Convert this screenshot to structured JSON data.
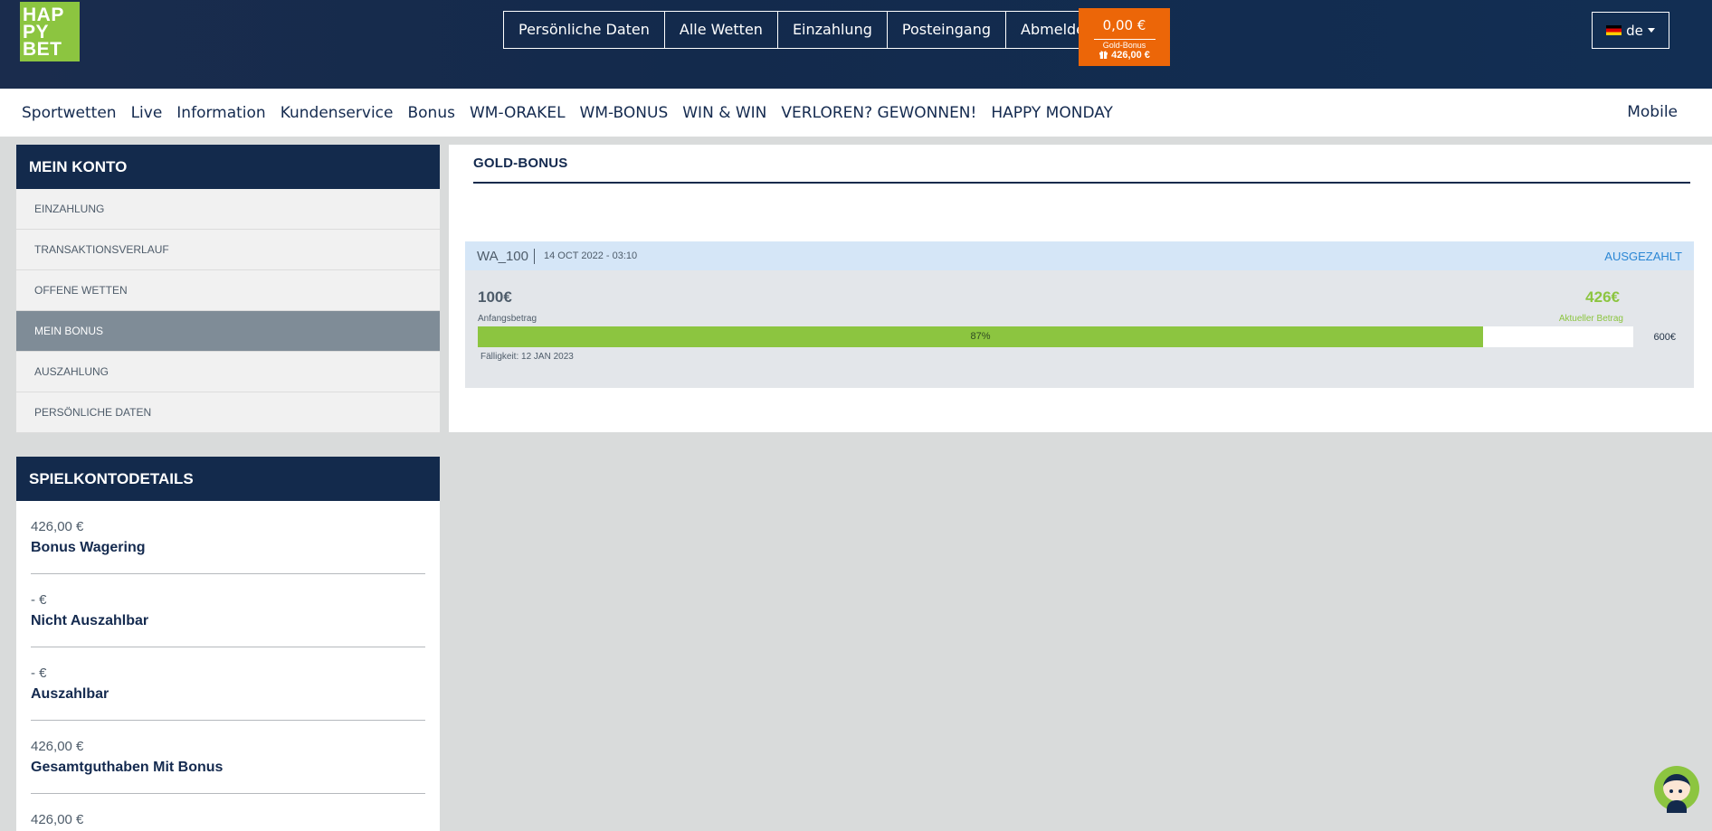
{
  "header": {
    "logo_lines": [
      "HAP",
      "PY",
      "BET"
    ],
    "top_nav": [
      "Persönliche Daten",
      "Alle Wetten",
      "Einzahlung",
      "Posteingang",
      "Abmelden"
    ],
    "balance": {
      "amount": "0,00 €",
      "gold_bonus_label": "Gold-Bonus",
      "gold_bonus_value": "426,00 €"
    },
    "language": {
      "code": "de",
      "flag": "germany-flag-icon"
    }
  },
  "main_nav": {
    "items": [
      "Sportwetten",
      "Live",
      "Information",
      "Kundenservice",
      "Bonus",
      "WM-ORAKEL",
      "WM-BONUS",
      "WIN & WIN",
      "VERLOREN? GEWONNEN!",
      "HAPPY MONDAY"
    ],
    "mobile": "Mobile"
  },
  "sidebar": {
    "title": "MEIN KONTO",
    "items": [
      "EINZAHLUNG",
      "TRANSAKTIONSVERLAUF",
      "OFFENE WETTEN",
      "MEIN BONUS",
      "AUSZAHLUNG",
      "PERSÖNLICHE DATEN"
    ],
    "active_index": 3
  },
  "account_details": {
    "title": "SPIELKONTODETAILS",
    "rows": [
      {
        "value": "426,00 €",
        "label": "Bonus Wagering"
      },
      {
        "value": "- €",
        "label": "Nicht Auszahlbar"
      },
      {
        "value": "- €",
        "label": "Auszahlbar"
      },
      {
        "value": "426,00 €",
        "label": "Gesamtguthaben Mit Bonus"
      },
      {
        "value": "426,00 €",
        "label": ""
      }
    ]
  },
  "content": {
    "title": "GOLD-BONUS",
    "bonus": {
      "code": "WA_100",
      "date": "14 OCT 2022 - 03:10",
      "status": "AUSGEZAHLT",
      "start_amount": "100€",
      "start_label": "Anfangsbetrag",
      "current_amount": "426€",
      "current_label": "Aktueller Betrag",
      "progress_label": "87%",
      "progress_fraction": 0.87,
      "max_amount": "600€",
      "due_date": "Fälligkeit: 12 JAN 2023"
    }
  },
  "colors": {
    "brand_green": "#8cc540",
    "navy": "#132a4c",
    "orange": "#ec6608",
    "link_blue": "#2a86d4"
  }
}
